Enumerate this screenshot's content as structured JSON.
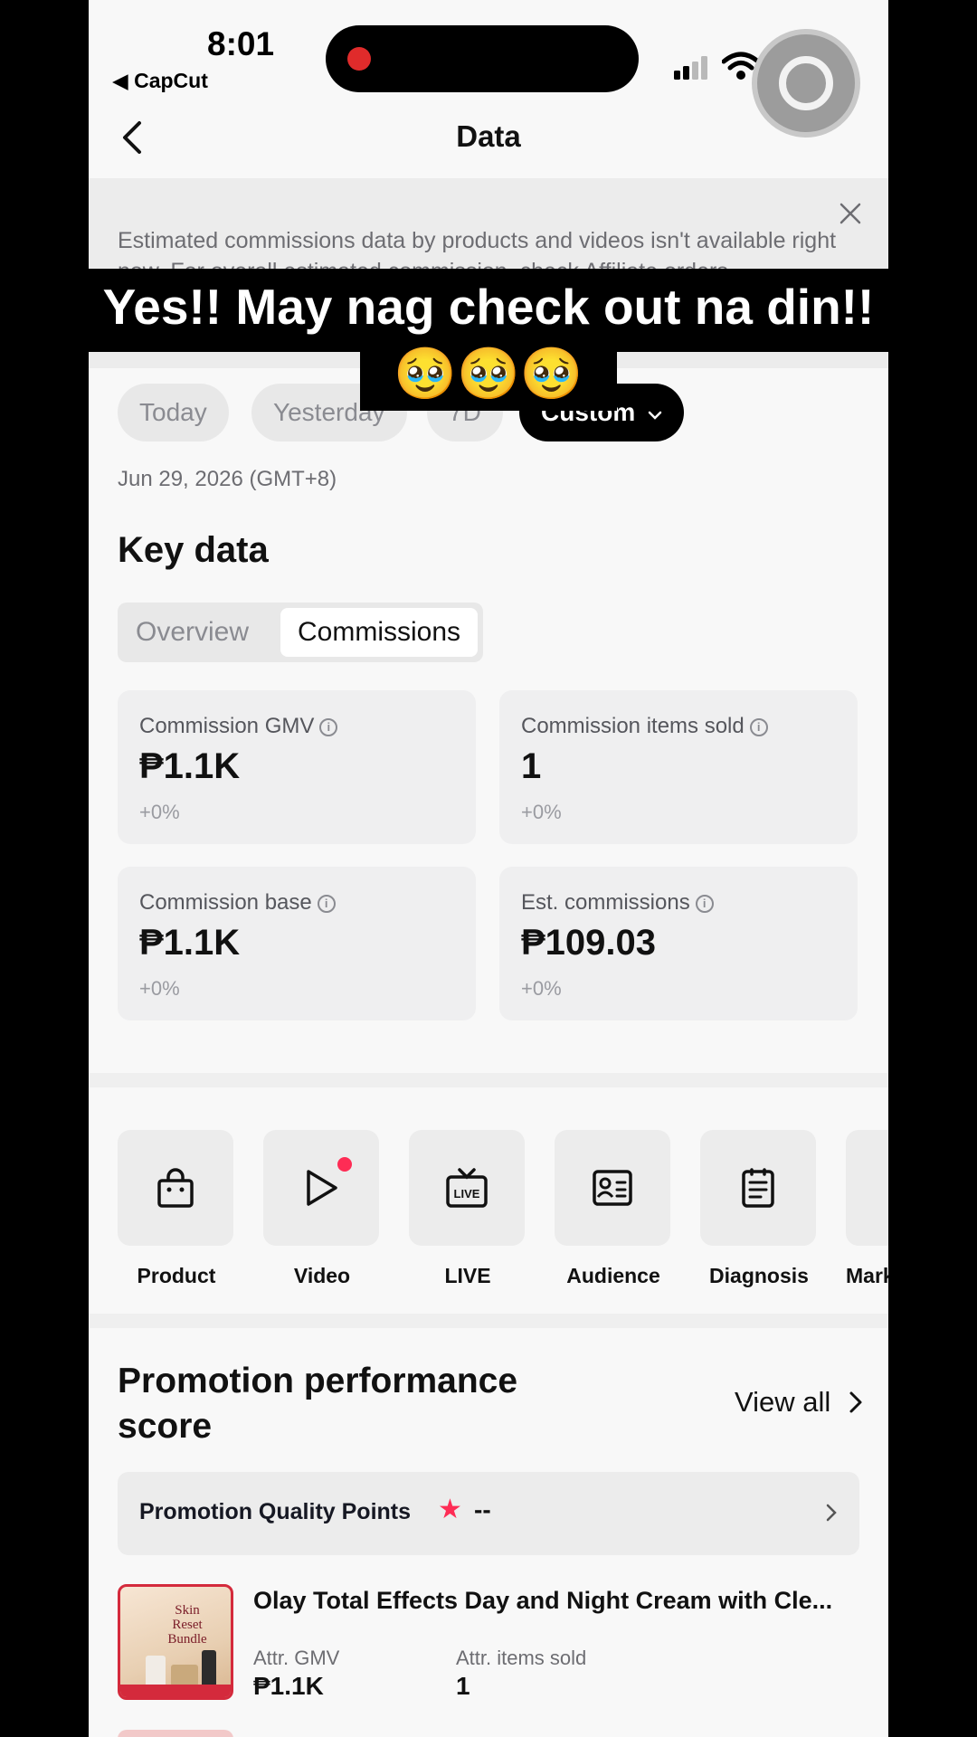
{
  "status_bar": {
    "time": "8:01",
    "back_app": "◀ CapCut"
  },
  "header": {
    "title": "Data"
  },
  "notice": {
    "text": "Estimated commissions data by products and videos isn't available right now. For overall estimated commission, check Affiliate orders."
  },
  "caption": {
    "line1": "Yes!! May nag check out na din!!",
    "line2": "🥹🥹🥹"
  },
  "date_range": {
    "chips": [
      "Today",
      "Yesterday",
      "7D",
      "Custom"
    ],
    "active": "Custom",
    "date": "Jun 29, 2026 (GMT+8)"
  },
  "key_data": {
    "title": "Key data",
    "tabs": [
      "Overview",
      "Commissions"
    ],
    "active_tab": "Commissions",
    "metrics": [
      {
        "label": "Commission GMV",
        "value": "₱1.1K",
        "change": "+0%"
      },
      {
        "label": "Commission items sold",
        "value": "1",
        "change": "+0%"
      },
      {
        "label": "Commission base",
        "value": "₱1.1K",
        "change": "+0%"
      },
      {
        "label": "Est. commissions",
        "value": "₱109.03",
        "change": "+0%"
      }
    ]
  },
  "tools": [
    {
      "label": "Product",
      "icon": "shopping-bag-icon"
    },
    {
      "label": "Video",
      "icon": "play-icon"
    },
    {
      "label": "LIVE",
      "icon": "live-tv-icon"
    },
    {
      "label": "Audience",
      "icon": "id-card-icon"
    },
    {
      "label": "Diagnosis",
      "icon": "clipboard-icon"
    },
    {
      "label": "Mark",
      "icon": ""
    }
  ],
  "promotion": {
    "title": "Promotion performance score",
    "view_all": "View all",
    "quality_label": "Promotion Quality Points",
    "quality_value": "--",
    "product": {
      "name": "Olay Total Effects Day and Night Cream with Cle...",
      "gmv_label": "Attr. GMV",
      "gmv_value": "₱1.1K",
      "sold_label": "Attr. items sold",
      "sold_value": "1",
      "thumb_text": "Skin Reset Bundle"
    }
  },
  "colors": {
    "accent": "#fe2c55",
    "active_chip": "#000000",
    "card_bg": "#efeff0"
  }
}
